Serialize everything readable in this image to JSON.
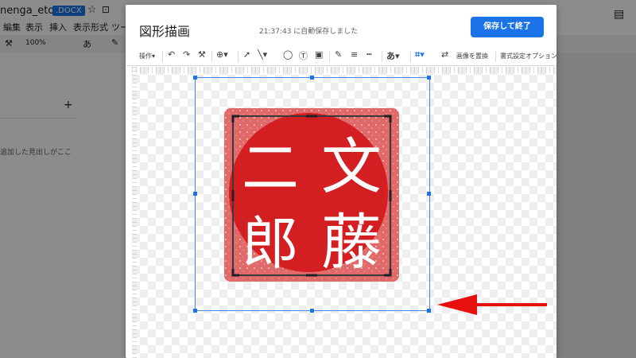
{
  "docs": {
    "doc_title": "nenga_eto",
    "file_badge": ".DOCX",
    "menu": [
      "編集",
      "表示",
      "挿入",
      "表示形式",
      "ツー"
    ],
    "zoom": "100%",
    "sidebar_plus": "+",
    "sidebar_hint": "追加した見出しがここ"
  },
  "dialog": {
    "title": "図形描画",
    "autosave": "21:37:43 に自動保存しました",
    "save_button": "保存して終了",
    "toolbar": {
      "actions": "操作",
      "replace_image": "画像を置換",
      "format_options": "書式設定オプション",
      "text_glyph": "あ"
    }
  },
  "stamp": {
    "characters": [
      "二",
      "文",
      "郎",
      "藤"
    ],
    "fill_color": "#d31f21",
    "border_color": "#e06a6a"
  },
  "annotation": {
    "arrow_color": "#e8100f"
  }
}
